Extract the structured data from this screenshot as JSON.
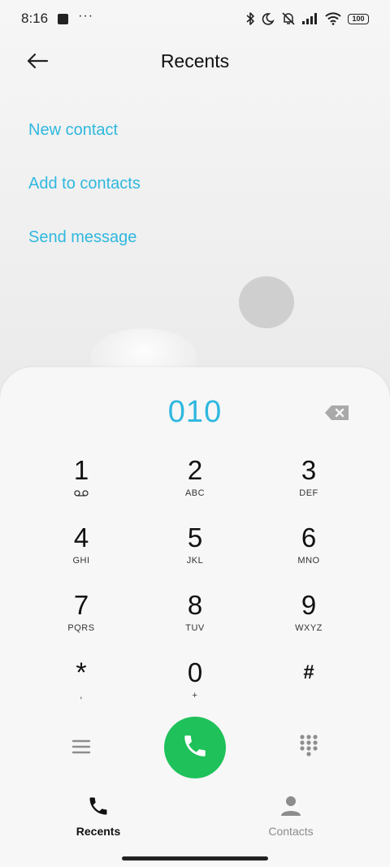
{
  "status_bar": {
    "time": "8:16",
    "dots": "···",
    "battery": "100"
  },
  "header": {
    "title": "Recents"
  },
  "actions": [
    {
      "label": "New contact"
    },
    {
      "label": "Add to contacts"
    },
    {
      "label": "Send message"
    }
  ],
  "dialer": {
    "number": "010",
    "keys": [
      {
        "digit": "1",
        "letters": ""
      },
      {
        "digit": "2",
        "letters": "ABC"
      },
      {
        "digit": "3",
        "letters": "DEF"
      },
      {
        "digit": "4",
        "letters": "GHI"
      },
      {
        "digit": "5",
        "letters": "JKL"
      },
      {
        "digit": "6",
        "letters": "MNO"
      },
      {
        "digit": "7",
        "letters": "PQRS"
      },
      {
        "digit": "8",
        "letters": "TUV"
      },
      {
        "digit": "9",
        "letters": "WXYZ"
      },
      {
        "digit": "*",
        "letters": ","
      },
      {
        "digit": "0",
        "letters": "+"
      },
      {
        "digit": "#",
        "letters": ""
      }
    ]
  },
  "bottom_nav": {
    "recents": "Recents",
    "contacts": "Contacts"
  },
  "colors": {
    "accent": "#2fb8df",
    "call": "#1ec15a",
    "inactive_nav": "#8c8c8c"
  },
  "icons": {
    "back": "arrow-left-icon",
    "backspace": "backspace-icon",
    "voicemail": "voicemail-icon",
    "menu": "menu-icon",
    "call": "phone-icon",
    "dialpad": "dialpad-icon",
    "recents": "phone-icon",
    "contacts": "person-icon"
  }
}
